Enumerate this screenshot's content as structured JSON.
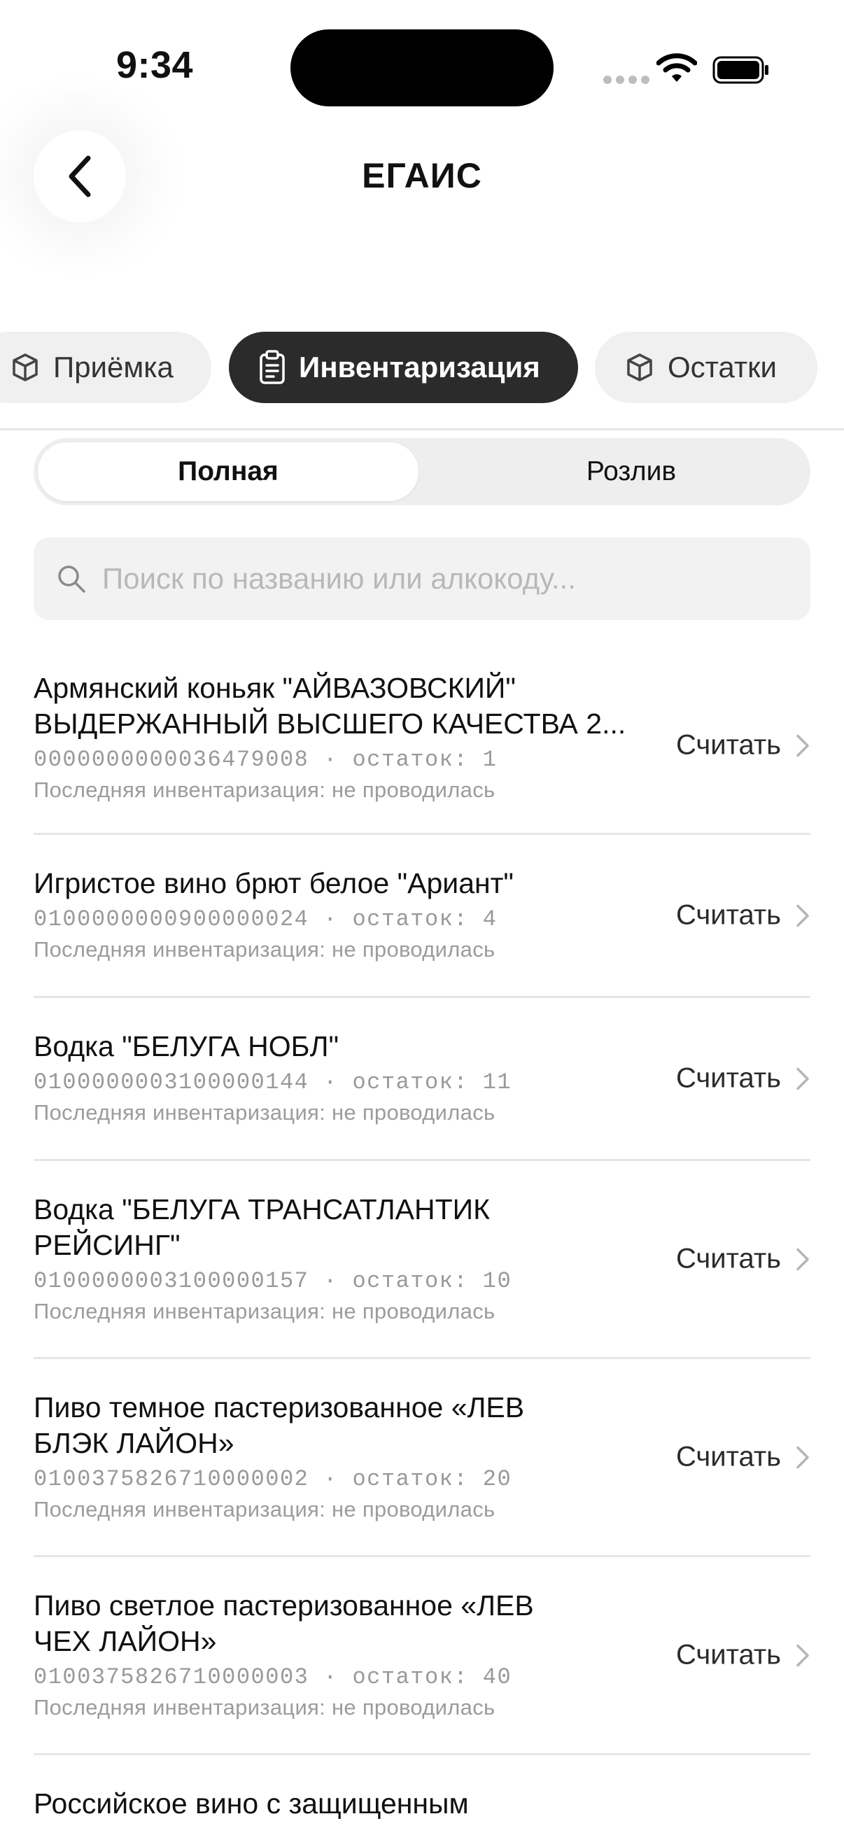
{
  "status_bar": {
    "time": "9:34"
  },
  "header": {
    "title": "ЕГАИС"
  },
  "mode_tabs": [
    {
      "label": "Приёмка",
      "icon": "box-icon",
      "active": false
    },
    {
      "label": "Инвентаризация",
      "icon": "clipboard-icon",
      "active": true
    },
    {
      "label": "Остатки",
      "icon": "box-icon",
      "active": false
    }
  ],
  "segments": {
    "full": "Полная",
    "pour": "Розлив",
    "selected": "full"
  },
  "search": {
    "placeholder": "Поиск по названию или алкокоду...",
    "value": ""
  },
  "count_label": "Считать",
  "items": [
    {
      "name_line1": "Армянский коньяк \"АЙВАЗОВСКИЙ\"",
      "name_line2": "ВЫДЕРЖАННЫЙ ВЫСШЕГО КАЧЕСТВА 2...",
      "meta": "0000000000036479008 · остаток: 1",
      "last": "Последняя инвентаризация: не проводилась"
    },
    {
      "name_line1": "Игристое вино брют белое \"Ариант\"",
      "name_line2": "",
      "meta": "0100000000900000024 · остаток: 4",
      "last": "Последняя инвентаризация: не проводилась"
    },
    {
      "name_line1": "Водка \"БЕЛУГА НОБЛ\"",
      "name_line2": "",
      "meta": "0100000003100000144 · остаток: 11",
      "last": "Последняя инвентаризация: не проводилась"
    },
    {
      "name_line1": "Водка \"БЕЛУГА ТРАНСАТЛАНТИК",
      "name_line2": "РЕЙСИНГ\"",
      "meta": "0100000003100000157 · остаток: 10",
      "last": "Последняя инвентаризация: не проводилась"
    },
    {
      "name_line1": "Пиво темное пастеризованное «ЛЕВ",
      "name_line2": "БЛЭК ЛАЙОН»",
      "meta": "0100375826710000002 · остаток: 20",
      "last": "Последняя инвентаризация: не проводилась"
    },
    {
      "name_line1": "Пиво светлое пастеризованное «ЛЕВ",
      "name_line2": "ЧЕХ ЛАЙОН»",
      "meta": "0100375826710000003 · остаток: 40",
      "last": "Последняя инвентаризация: не проводилась"
    },
    {
      "name_line1": "Российское вино с защищенным",
      "name_line2": "",
      "meta": "",
      "last": ""
    }
  ]
}
